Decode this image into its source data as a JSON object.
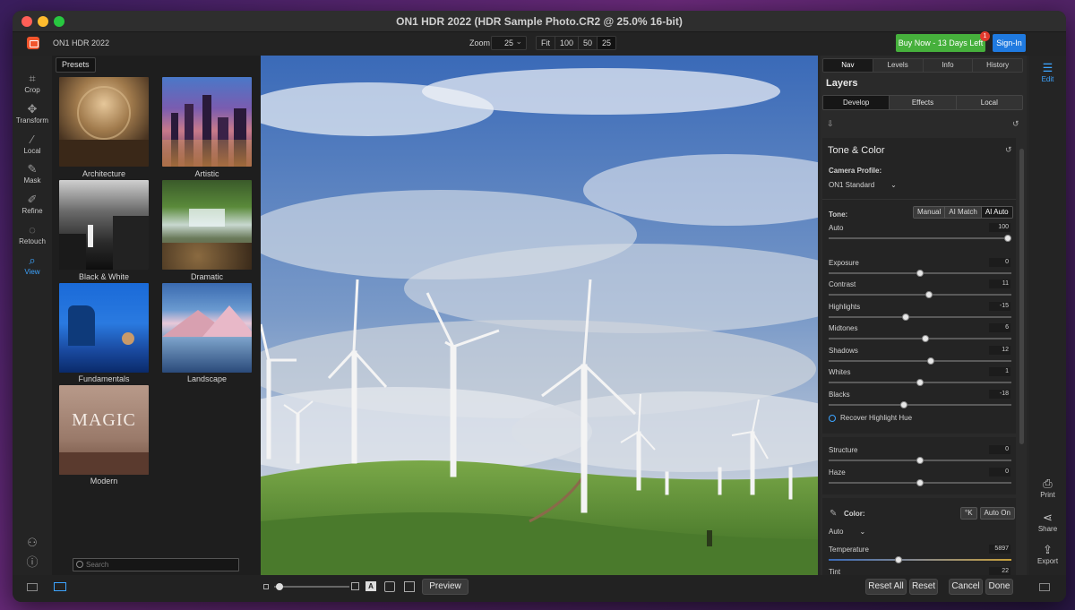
{
  "window": {
    "title": "ON1 HDR 2022 (HDR Sample Photo.CR2 @ 25.0% 16-bit)"
  },
  "toolbar": {
    "app_name": "ON1 HDR 2022",
    "zoom_label": "Zoom",
    "zoom_value": "25",
    "zoom_buttons": [
      "Fit",
      "100",
      "50",
      "25"
    ],
    "buy_label": "Buy Now - 13 Days Left",
    "buy_badge": "1",
    "signin_label": "Sign-In"
  },
  "tools": [
    {
      "label": "Crop",
      "icon": "crop-icon"
    },
    {
      "label": "Transform",
      "icon": "transform-icon"
    },
    {
      "label": "Local",
      "icon": "brush-icon"
    },
    {
      "label": "Mask",
      "icon": "mask-icon"
    },
    {
      "label": "Refine",
      "icon": "refine-icon"
    },
    {
      "label": "Retouch",
      "icon": "retouch-icon"
    },
    {
      "label": "View",
      "icon": "view-icon"
    }
  ],
  "presets": {
    "tab_label": "Presets",
    "items": [
      "Architecture",
      "Artistic",
      "Black & White",
      "Dramatic",
      "Fundamentals",
      "Landscape",
      "Modern"
    ],
    "modern_thumb_text": "MAGIC",
    "search_placeholder": "Search"
  },
  "right_modules": {
    "edit": "Edit",
    "print": "Print",
    "share": "Share",
    "export": "Export"
  },
  "panel": {
    "tabs": [
      "Nav",
      "Levels",
      "Info",
      "History"
    ],
    "active_tab": "Nav",
    "layers_title": "Layers",
    "subtabs": [
      "Develop",
      "Effects",
      "Local"
    ],
    "active_subtab": "Develop",
    "tone_color": {
      "title": "Tone & Color",
      "camera_profile_label": "Camera Profile:",
      "camera_profile_value": "ON1 Standard",
      "tone_label": "Tone:",
      "tone_modes": [
        "Manual",
        "AI Match",
        "AI Auto"
      ],
      "active_tone_mode": "AI Auto",
      "sliders": [
        {
          "label": "Auto",
          "value": "100",
          "pos": 1.0
        },
        {
          "label": "Exposure",
          "value": "0",
          "pos": 0.5
        },
        {
          "label": "Contrast",
          "value": "11",
          "pos": 0.55
        },
        {
          "label": "Highlights",
          "value": "-15",
          "pos": 0.42
        },
        {
          "label": "Midtones",
          "value": "6",
          "pos": 0.53
        },
        {
          "label": "Shadows",
          "value": "12",
          "pos": 0.56
        },
        {
          "label": "Whites",
          "value": "1",
          "pos": 0.5
        },
        {
          "label": "Blacks",
          "value": "-18",
          "pos": 0.41
        }
      ],
      "recover_label": "Recover Highlight Hue",
      "structure": {
        "label": "Structure",
        "value": "0",
        "pos": 0.5
      },
      "haze": {
        "label": "Haze",
        "value": "0",
        "pos": 0.5
      }
    },
    "color": {
      "label": "Color:",
      "eyedropper_btn": "°K",
      "auto_on_btn": "Auto On",
      "mode": "Auto",
      "temperature": {
        "label": "Temperature",
        "value": "5897",
        "pos": 0.38
      },
      "tint": {
        "label": "Tint",
        "value": "22",
        "pos": 0.58
      }
    }
  },
  "bottom": {
    "preview": "Preview",
    "reset_all": "Reset All",
    "reset": "Reset",
    "cancel": "Cancel",
    "done": "Done"
  },
  "colors": {
    "accent_blue": "#3da4ff",
    "buy_green": "#46b03c",
    "signin_blue": "#1f7ae0"
  }
}
